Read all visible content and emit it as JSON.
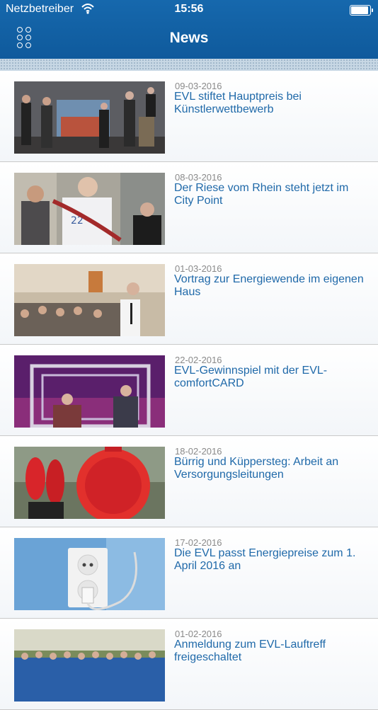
{
  "status_bar": {
    "carrier": "Netzbetreiber",
    "time": "15:56",
    "battery_level": 0.85
  },
  "nav": {
    "title": "News",
    "menu_icon": "grid-dots-icon"
  },
  "news": [
    {
      "date": "09-03-2016",
      "title": "EVL stiftet Hauptpreis bei Künstlerwettbewerb"
    },
    {
      "date": "08-03-2016",
      "title": "Der Riese vom Rhein steht jetzt im City Point"
    },
    {
      "date": "01-03-2016",
      "title": "Vortrag zur Energiewende im eigenen Haus"
    },
    {
      "date": "22-02-2016",
      "title": "EVL-Gewinnspiel mit der EVL-comfortCARD"
    },
    {
      "date": "18-02-2016",
      "title": "Bürrig und Küppersteg: Arbeit an Versorgungsleitungen"
    },
    {
      "date": "17-02-2016",
      "title": "Die EVL passt Energiepreise zum 1. April 2016 an"
    },
    {
      "date": "01-02-2016",
      "title": "Anmeldung zum EVL-Lauftreff freigeschaltet"
    }
  ],
  "colors": {
    "header": "#1668ad",
    "link": "#1f69a9",
    "date": "#8a8a8a"
  }
}
